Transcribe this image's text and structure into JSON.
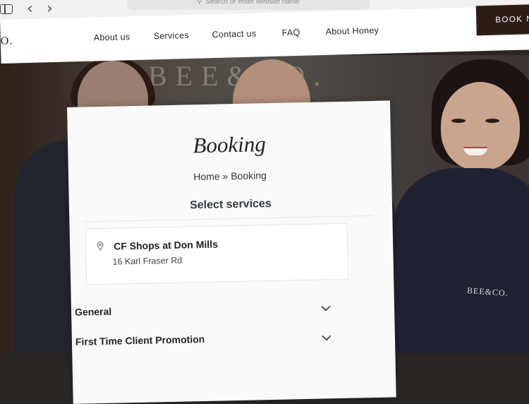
{
  "browser": {
    "address_placeholder": "Search or enter website name",
    "icons": [
      "sidebar-icon",
      "back-icon",
      "forward-icon",
      "search-icon"
    ]
  },
  "header": {
    "logo": "O.",
    "menu": [
      "About us",
      "Services",
      "Contact us",
      "FAQ",
      "About Honey"
    ],
    "book_label": "BOOK N"
  },
  "hero": {
    "wall_sign": "BEE&CO.",
    "shirt_logo": "BEE&CO."
  },
  "booking": {
    "title": "Booking",
    "breadcrumb": "Home » Booking",
    "section_title": "Select services",
    "location": {
      "name": "CF Shops at Don Mills",
      "address": "16 Karl Fraser Rd"
    },
    "categories": [
      "General",
      "First Time Client Promotion"
    ]
  }
}
